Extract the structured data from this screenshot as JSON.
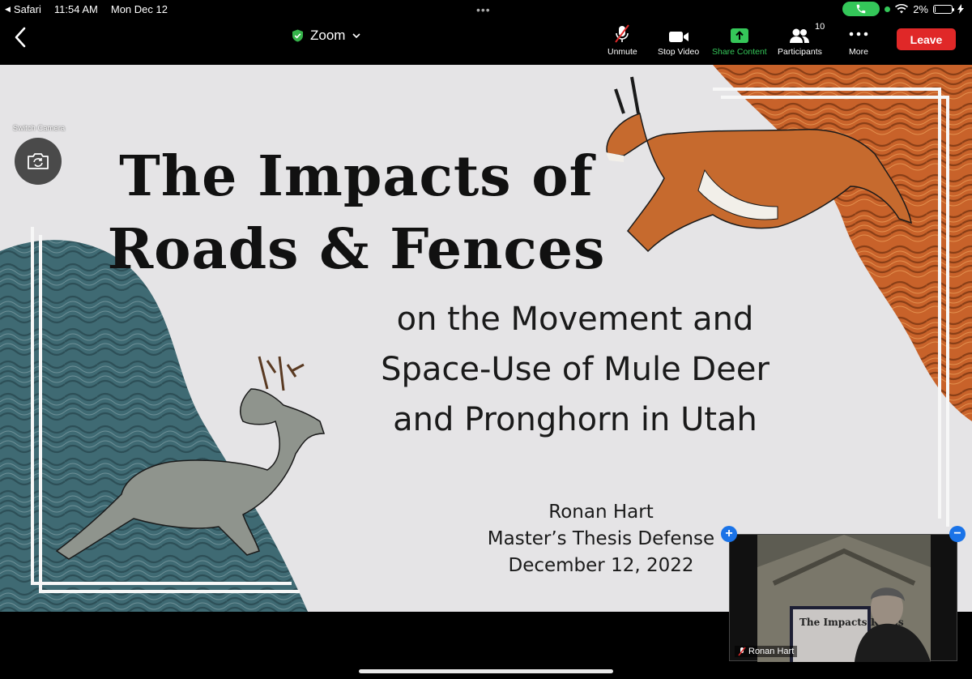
{
  "status_bar": {
    "back_app": "Safari",
    "time": "11:54 AM",
    "date": "Mon Dec 12",
    "battery_text": "2%",
    "battery_level": 0.02
  },
  "toolbar": {
    "meeting_title": "Zoom",
    "unmute_label": "Unmute",
    "stop_video_label": "Stop Video",
    "share_content_label": "Share Content",
    "participants_label": "Participants",
    "participants_count": "10",
    "more_label": "More",
    "leave_label": "Leave"
  },
  "colors": {
    "leave": "#e02828",
    "share": "#35c759",
    "teal_art": "#3f6a73",
    "orange_art": "#c8622a"
  },
  "controls": {
    "switch_camera_label": "Switch Camera"
  },
  "slide": {
    "title_line1": "The Impacts of",
    "title_line2": "Roads & Fences",
    "subtitle_line1": "on the Movement and",
    "subtitle_line2": "Space-Use of Mule Deer",
    "subtitle_line3": "and Pronghorn in Utah",
    "author": "Ronan Hart",
    "event": "Master’s Thesis Defense",
    "date": "December 12, 2022"
  },
  "self_view": {
    "name": "Ronan Hart",
    "mini_slide_text": "The Impacts Roads"
  }
}
